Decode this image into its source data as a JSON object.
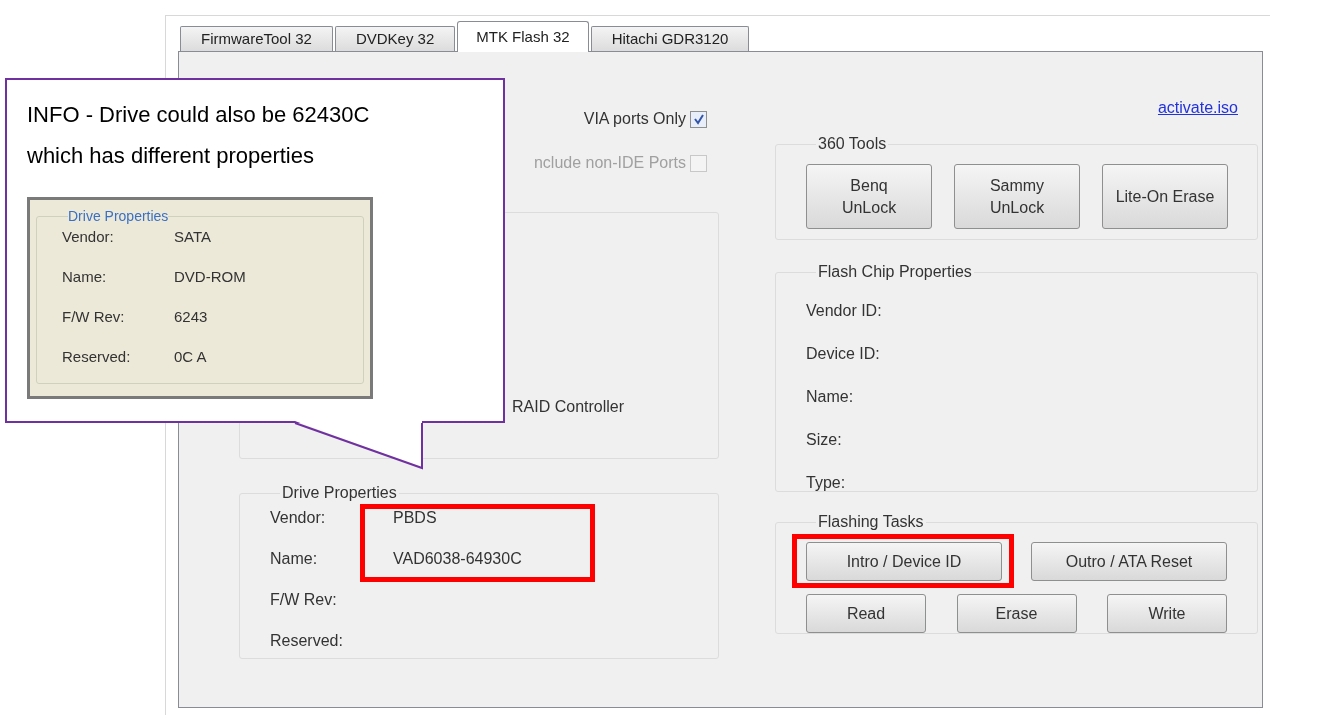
{
  "tabs": [
    {
      "label": "FirmwareTool 32",
      "selected": false
    },
    {
      "label": "DVDKey 32",
      "selected": false
    },
    {
      "label": "MTK Flash 32",
      "selected": true
    },
    {
      "label": "Hitachi GDR3120",
      "selected": false
    }
  ],
  "callout": {
    "text": "INFO - Drive could also be 62430C which has different properties",
    "inset": {
      "title": "Drive Properties",
      "rows": [
        {
          "label": "Vendor:",
          "value": "SATA"
        },
        {
          "label": "Name:",
          "value": "DVD-ROM"
        },
        {
          "label": "F/W Rev:",
          "value": "6243"
        },
        {
          "label": "Reserved:",
          "value": "0C A"
        }
      ]
    }
  },
  "port_options": [
    {
      "label": "VIA ports Only",
      "checked": true,
      "disabled": false
    },
    {
      "label": "nclude non-IDE Ports",
      "checked": false,
      "disabled": true
    }
  ],
  "controller_text": "RAID Controller",
  "drive_properties": {
    "title": "Drive Properties",
    "rows": [
      {
        "label": "Vendor:",
        "value": "PBDS",
        "highlighted": true
      },
      {
        "label": "Name:",
        "value": "VAD6038-64930C",
        "highlighted": true
      },
      {
        "label": "F/W Rev:",
        "highlighted": false
      },
      {
        "label": "Reserved:",
        "highlighted": false
      }
    ]
  },
  "link": "activate.iso",
  "tools_360": {
    "title": "360 Tools",
    "buttons": [
      {
        "label": "Benq\nUnLock"
      },
      {
        "label": "Sammy\nUnLock"
      },
      {
        "label": "Lite-On Erase"
      }
    ]
  },
  "flash_chip": {
    "title": "Flash Chip Properties",
    "rows": [
      {
        "label": "Vendor ID:"
      },
      {
        "label": "Device ID:"
      },
      {
        "label": "Name:"
      },
      {
        "label": "Size:"
      },
      {
        "label": "Type:"
      }
    ]
  },
  "flashing_tasks": {
    "title": "Flashing Tasks",
    "top_buttons": [
      {
        "label": "Intro / Device ID",
        "highlighted": true
      },
      {
        "label": "Outro / ATA Reset",
        "highlighted": false
      }
    ],
    "bottom_buttons": [
      {
        "label": "Read",
        "highlighted": false
      },
      {
        "label": "Erase",
        "highlighted": false
      },
      {
        "label": "Write",
        "highlighted": false
      }
    ]
  }
}
